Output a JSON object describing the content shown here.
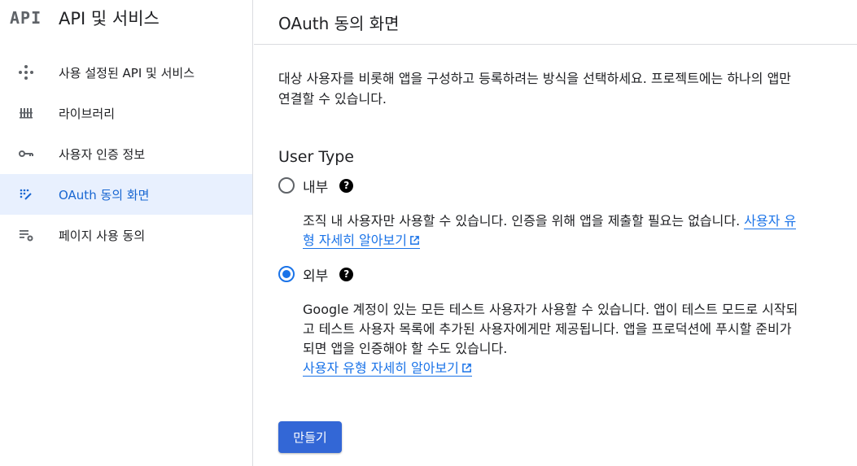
{
  "sidebar": {
    "logo": "API",
    "title": "API 및 서비스",
    "items": [
      {
        "label": "사용 설정된 API 및 서비스",
        "icon": "diamond-dots-icon"
      },
      {
        "label": "라이브러리",
        "icon": "library-icon"
      },
      {
        "label": "사용자 인증 정보",
        "icon": "key-icon"
      },
      {
        "label": "OAuth 동의 화면",
        "icon": "oauth-consent-icon",
        "active": true
      },
      {
        "label": "페이지 사용 동의",
        "icon": "list-settings-icon"
      }
    ]
  },
  "main": {
    "title": "OAuth 동의 화면",
    "intro": "대상 사용자를 비롯해 앱을 구성하고 등록하려는 방식을 선택하세요. 프로젝트에는 하나의 앱만 연결할 수 있습니다.",
    "section_title": "User Type",
    "options": {
      "internal": {
        "label": "내부",
        "checked": false,
        "description": "조직 내 사용자만 사용할 수 있습니다. 인증을 위해 앱을 제출할 필요는 없습니다. ",
        "link": "사용자 유형 자세히 알아보기"
      },
      "external": {
        "label": "외부",
        "checked": true,
        "description": "Google 계정이 있는 모든 테스트 사용자가 사용할 수 있습니다. 앱이 테스트 모드로 시작되고 테스트 사용자 목록에 추가된 사용자에게만 제공됩니다. 앱을 프로덕션에 푸시할 준비가 되면 앱을 인증해야 할 수도 있습니다.",
        "link": "사용자 유형 자세히 알아보기"
      }
    },
    "help_glyph": "?",
    "create_button": "만들기"
  },
  "colors": {
    "accent": "#1a73e8",
    "active_bg": "#e8f0fe",
    "button_bg": "#3367d6",
    "border": "#dadce0"
  }
}
